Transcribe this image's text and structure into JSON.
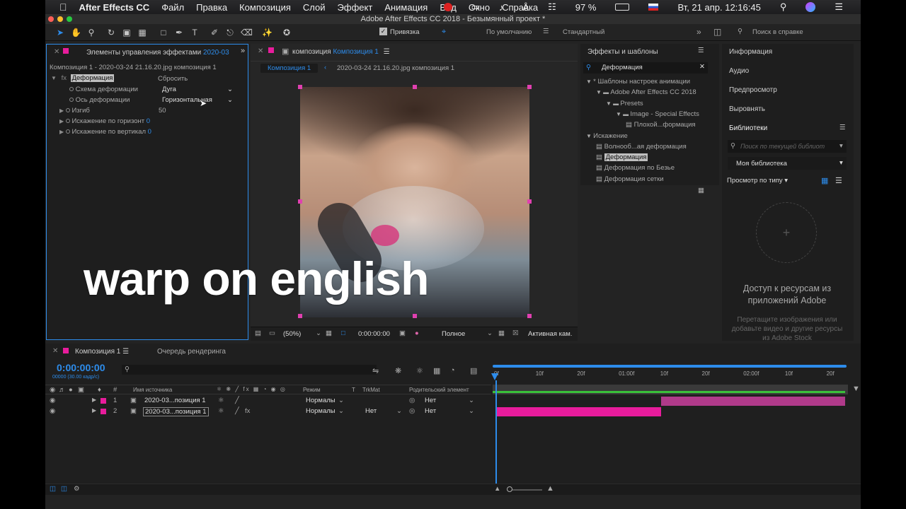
{
  "menubar": {
    "app_name": "After Effects CC",
    "items": [
      "Файл",
      "Правка",
      "Композиция",
      "Слой",
      "Эффект",
      "Анимация",
      "Вид",
      "Окно",
      "Справка"
    ],
    "battery": "97 %",
    "datetime": "Вт, 21 апр.  12:16:45"
  },
  "window": {
    "title": "Adobe After Effects CC 2018 - Безымянный проект *"
  },
  "toolbar": {
    "snap_label": "Привязка",
    "workspace_default": "По умолчанию",
    "workspace_standard": "Стандартный",
    "search_placeholder": "Поиск в справке"
  },
  "effect_controls": {
    "tab_label": "Элементы управления эффектами",
    "tab_target": "2020-03",
    "breadcrumb": "Композиция 1 - 2020-03-24 21.16.20.jpg композиция 1",
    "effect_name": "Деформация",
    "reset_label": "Сбросить",
    "props": [
      {
        "label": "Схема деформации",
        "value": "Дуга"
      },
      {
        "label": "Ось деформации",
        "value": "Горизонтальная"
      },
      {
        "label": "Изгиб",
        "value": "50"
      },
      {
        "label": "Искажение по горизонт",
        "value": "0"
      },
      {
        "label": "Искажение по вертикал",
        "value": "0"
      }
    ]
  },
  "composition": {
    "tab_prefix": "композиция",
    "tab_name": "Композиция 1",
    "crumb_active": "Композиция 1",
    "crumb_layer": "2020-03-24 21.16.20.jpg композиция 1",
    "zoom": "(50%)",
    "timecode": "0:00:00:00",
    "quality": "Полное",
    "camera": "Активная кам."
  },
  "overlay_text": "warp on english",
  "effects_presets": {
    "title": "Эффекты и шаблоны",
    "search_value": "Деформация",
    "tree": [
      {
        "label": "* Шаблоны настроек анимации",
        "indent": 0,
        "kind": "arrow"
      },
      {
        "label": "Adobe After Effects CC 2018",
        "indent": 1,
        "kind": "folder"
      },
      {
        "label": "Presets",
        "indent": 2,
        "kind": "folder"
      },
      {
        "label": "Image - Special Effects",
        "indent": 3,
        "kind": "folder"
      },
      {
        "label": "Плохой...формация",
        "indent": 4,
        "kind": "fx"
      },
      {
        "label": "Искажение",
        "indent": 0,
        "kind": "arrow"
      },
      {
        "label": "Волнооб...ая деформация",
        "indent": 1,
        "kind": "fx"
      },
      {
        "label": "Деформация",
        "indent": 1,
        "kind": "fx",
        "selected": true
      },
      {
        "label": "Деформация по Безье",
        "indent": 1,
        "kind": "fx"
      },
      {
        "label": "Деформация сетки",
        "indent": 1,
        "kind": "fx"
      }
    ]
  },
  "side_panels": [
    "Информация",
    "Аудио",
    "Предпросмотр",
    "Выровнять"
  ],
  "libraries": {
    "title": "Библиотеки",
    "search_placeholder": "Поиск по текущей библиот",
    "library_name": "Моя библиотека",
    "view_label": "Просмотр по типу",
    "empty_title": "Доступ к ресурсам из приложений Adobe",
    "empty_hint": "Перетащите изображения или добавьте видео и другие ресурсы из Adobe Stock"
  },
  "timeline": {
    "tab_comp": "Композиция 1",
    "tab_render": "Очередь рендеринга",
    "timecode": "0:00:00:00",
    "timecode_sub": "00000 (30.00 кадр/с)",
    "columns": {
      "source": "Имя источника",
      "mode": "Режим",
      "t": "T",
      "trkmat": "TrkMat",
      "parent": "Родительский элемент"
    },
    "ruler": [
      "0f",
      "10f",
      "20f",
      "01:00f",
      "10f",
      "20f",
      "02:00f",
      "10f",
      "20f"
    ],
    "layers": [
      {
        "num": "1",
        "name": "2020-03...позиция 1",
        "mode": "Нормалы",
        "trkmat": "",
        "parent": "Нет"
      },
      {
        "num": "2",
        "name": "2020-03...позиция 1",
        "mode": "Нормалы",
        "trkmat": "Нет",
        "parent": "Нет"
      }
    ]
  },
  "colors": {
    "accent": "#2d8ceb",
    "label_pink": "#e81c9c",
    "bar_magenta": "#b03a8a"
  }
}
